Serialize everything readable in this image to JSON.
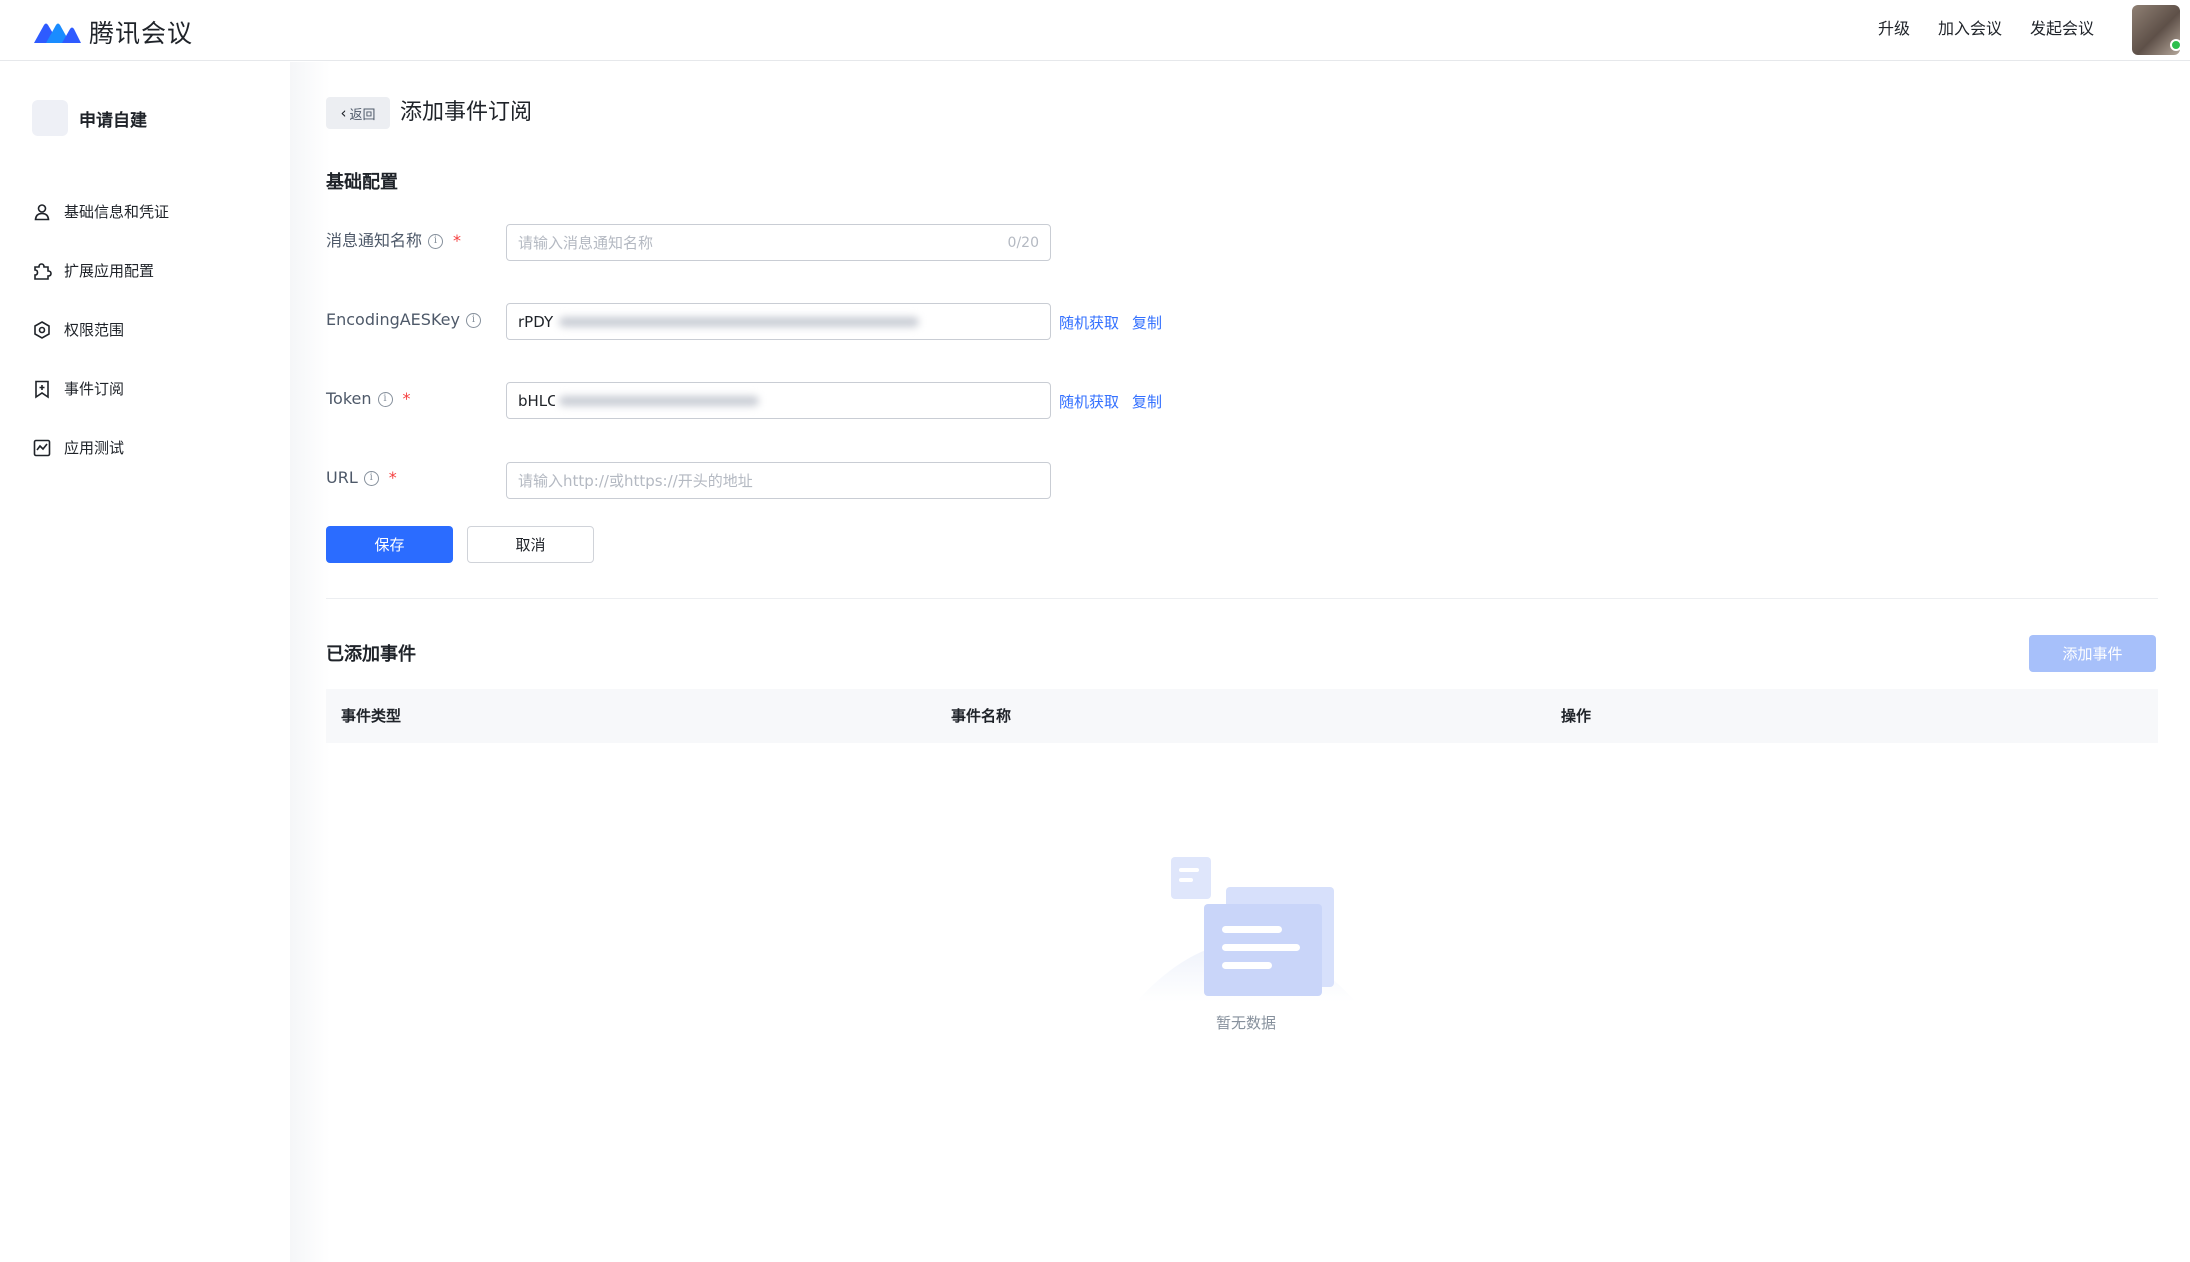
{
  "brand": {
    "name": "腾讯会议"
  },
  "topnav": {
    "upgrade": "升级",
    "join": "加入会议",
    "start": "发起会议"
  },
  "sidebar": {
    "app_name": "申请自建",
    "items": [
      {
        "label": "基础信息和凭证",
        "icon": "user-icon"
      },
      {
        "label": "扩展应用配置",
        "icon": "puzzle-icon"
      },
      {
        "label": "权限范围",
        "icon": "shield-gear-icon"
      },
      {
        "label": "事件订阅",
        "icon": "bookmark-plus-icon"
      },
      {
        "label": "应用测试",
        "icon": "chart-icon"
      }
    ]
  },
  "header": {
    "back_label": "返回",
    "title": "添加事件订阅"
  },
  "form": {
    "section_title": "基础配置",
    "name": {
      "label": "消息通知名称",
      "placeholder": "请输入消息通知名称",
      "count": "0/20"
    },
    "aes": {
      "label": "EncodingAESKey",
      "value": "rPDY",
      "random": "随机获取",
      "copy": "复制"
    },
    "token": {
      "label": "Token",
      "value": "bHLC",
      "random": "随机获取",
      "copy": "复制"
    },
    "url": {
      "label": "URL",
      "placeholder": "请输入http://或https://开头的地址"
    },
    "save": "保存",
    "cancel": "取消"
  },
  "events": {
    "section_title": "已添加事件",
    "add_button": "添加事件",
    "columns": [
      "事件类型",
      "事件名称",
      "操作"
    ],
    "empty_text": "暂无数据"
  },
  "colors": {
    "primary": "#2b6cff",
    "link": "#3370ff",
    "required": "#f53f3f"
  }
}
